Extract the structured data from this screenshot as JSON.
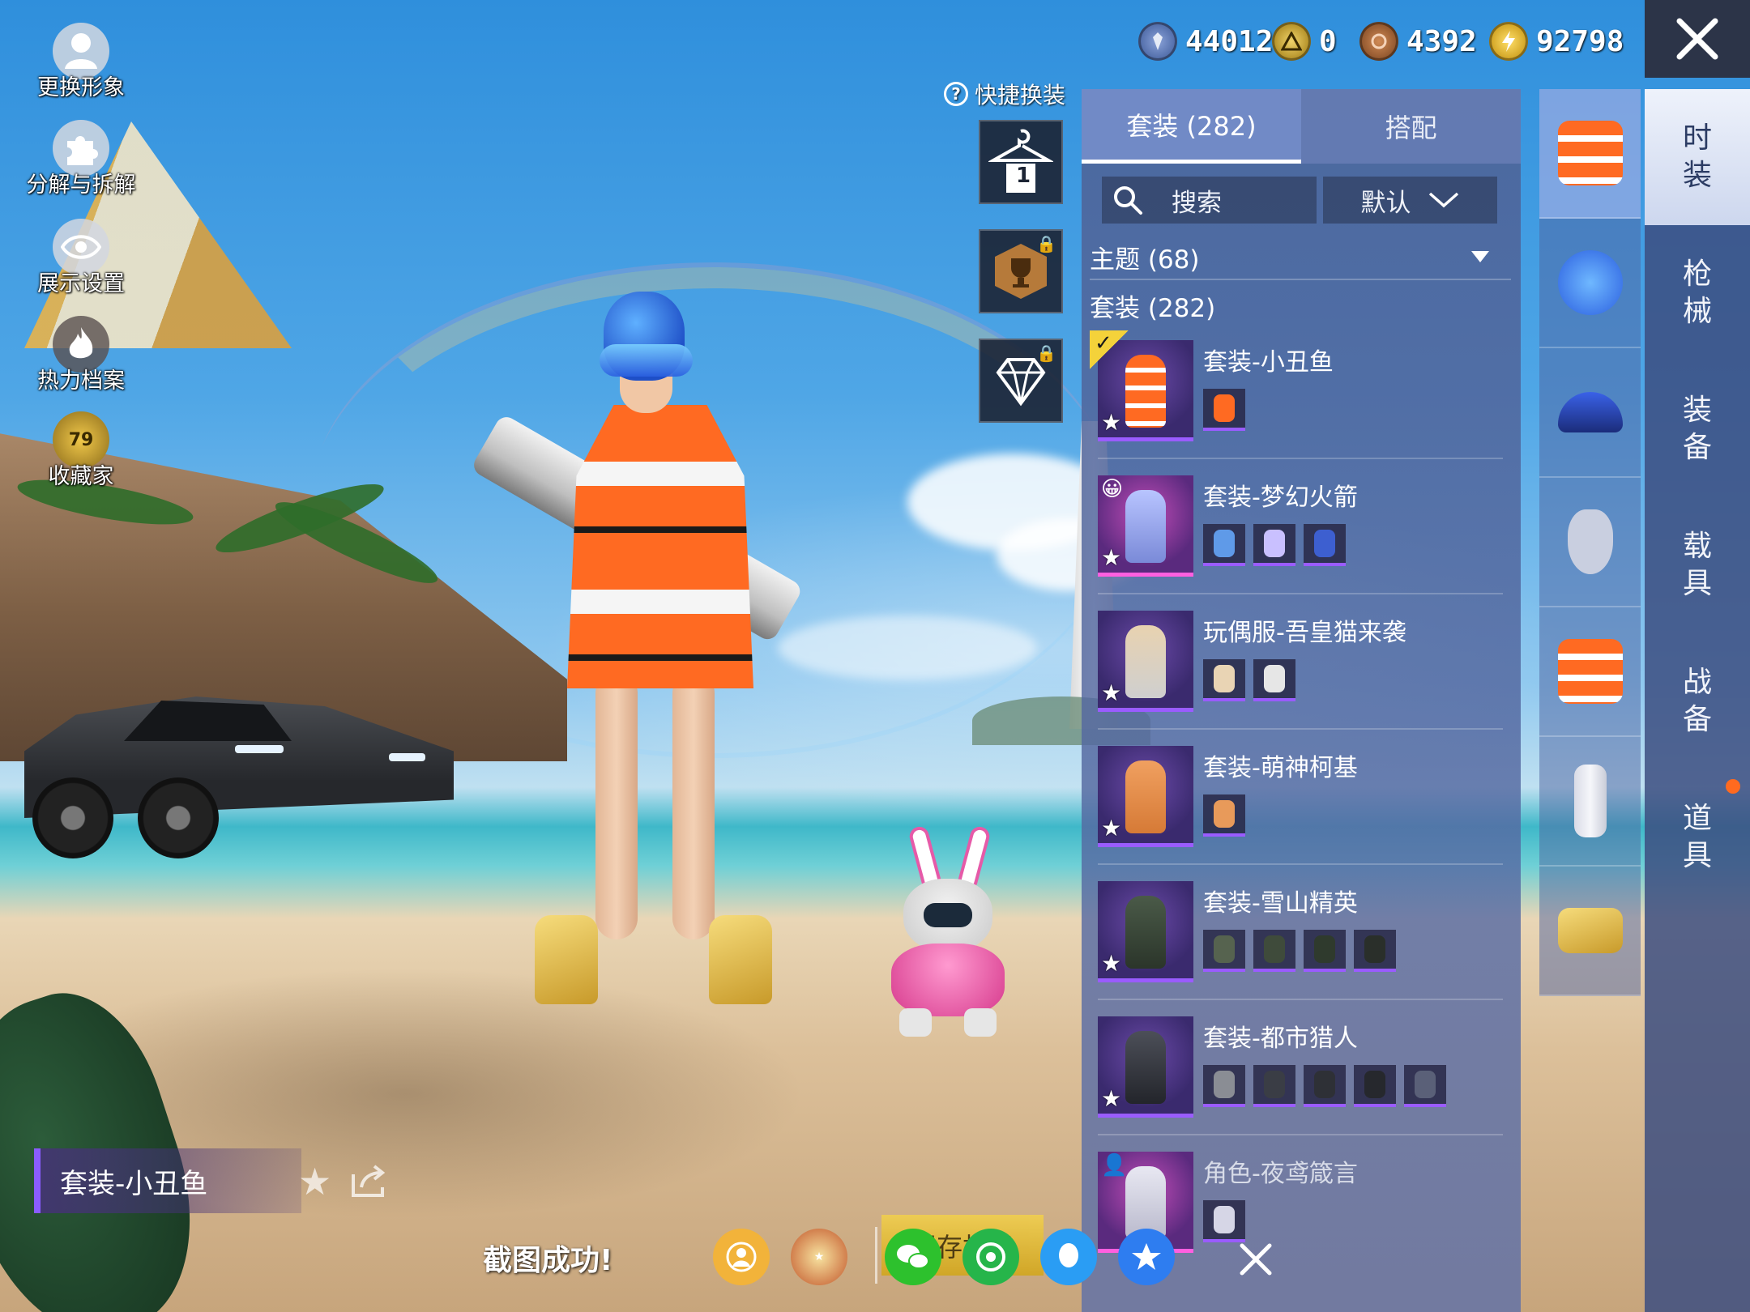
{
  "left_menu": [
    {
      "label": "更换形象",
      "icon": "avatar-icon"
    },
    {
      "label": "分解与拆解",
      "icon": "puzzle-icon"
    },
    {
      "label": "展示设置",
      "icon": "eye-icon"
    },
    {
      "label": "热力档案",
      "icon": "flame-icon"
    },
    {
      "label": "收藏家",
      "icon": "collector-badge-icon",
      "badge": "79"
    }
  ],
  "currencies": [
    {
      "value": "44012",
      "icon": "silver-coin-icon",
      "color": "#4a6aa8"
    },
    {
      "value": "0",
      "icon": "gold-emblem-coin-icon",
      "color": "#c9a227"
    },
    {
      "value": "4392",
      "icon": "bronze-coin-icon",
      "color": "#a0633a"
    },
    {
      "value": "92798",
      "icon": "lightning-coin-icon",
      "color": "#e0b51e"
    }
  ],
  "quick_change": {
    "title": "快捷换装",
    "slot_number": "1"
  },
  "panel": {
    "tabs": [
      "套装 (282)",
      "搭配"
    ],
    "search_label": "搜索",
    "sort_label": "默认",
    "theme_label": "主题 (68)",
    "count_label": "套装 (282)",
    "items": [
      {
        "name": "套装-小丑鱼",
        "selected": true,
        "parts": 1
      },
      {
        "name": "套装-梦幻火箭",
        "selected": false,
        "parts": 3
      },
      {
        "name": "玩偶服-吾皇猫来袭",
        "selected": false,
        "parts": 2
      },
      {
        "name": "套装-萌神柯基",
        "selected": false,
        "parts": 1
      },
      {
        "name": "套装-雪山精英",
        "selected": false,
        "parts": 4
      },
      {
        "name": "套装-都市猎人",
        "selected": false,
        "parts": 5
      },
      {
        "name": "角色-夜鸢箴言",
        "selected": false,
        "parts": 1
      }
    ]
  },
  "side_tabs": [
    "时装",
    "枪械",
    "装备",
    "载具",
    "战备",
    "道具"
  ],
  "current_outfit": "套装-小丑鱼",
  "toast": {
    "message": "截图成功!",
    "save_label": "保存相册"
  },
  "colors": {
    "accent_purple": "#9a5cff",
    "selected_check": "#f4d23a",
    "notification_dot": "#ff6a1f"
  }
}
